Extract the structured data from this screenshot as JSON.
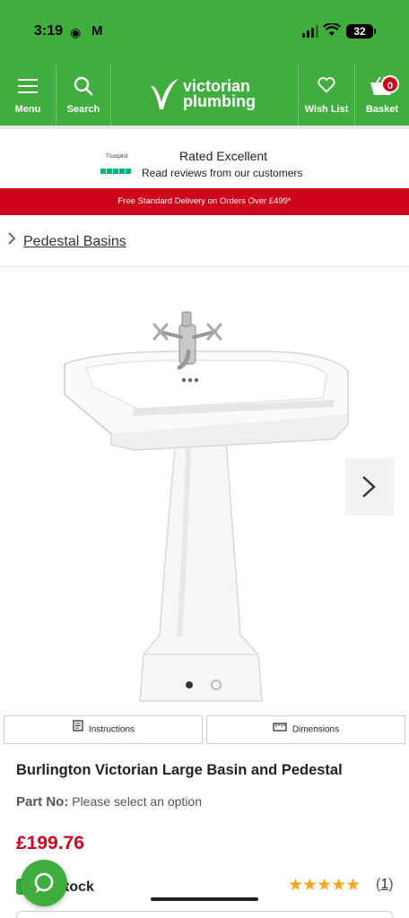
{
  "status_bar": {
    "time": "3:19",
    "battery": "32"
  },
  "header": {
    "menu_label": "Menu",
    "search_label": "Search",
    "brand_line1": "victorian",
    "brand_line2": "plumbing",
    "wishlist_label": "Wish List",
    "basket_label": "Basket",
    "basket_count": "0",
    "brand_color": "#3fae3f"
  },
  "trustpilot": {
    "logo_text": "Trustpilot",
    "rating_text": "Rated Excellent",
    "reviews_text": "Read reviews from our customers"
  },
  "promo": {
    "text": "Free Standard Delivery on Orders Over £499*",
    "color": "#d0021b"
  },
  "breadcrumb": {
    "label": "Pedestal Basins"
  },
  "gallery": {
    "image_count": 2,
    "active_index": 0
  },
  "product_tabs": [
    {
      "label": "Instructions",
      "icon": "document-icon"
    },
    {
      "label": "Dimensions",
      "icon": "ruler-icon"
    }
  ],
  "product": {
    "title": "Burlington Victorian Large Basin and Pedestal",
    "part_no_label": "Part No:",
    "part_no_value": "Please select an option",
    "price": "£199.76",
    "stock_label": "tock",
    "rating": 5,
    "review_count": "1"
  }
}
